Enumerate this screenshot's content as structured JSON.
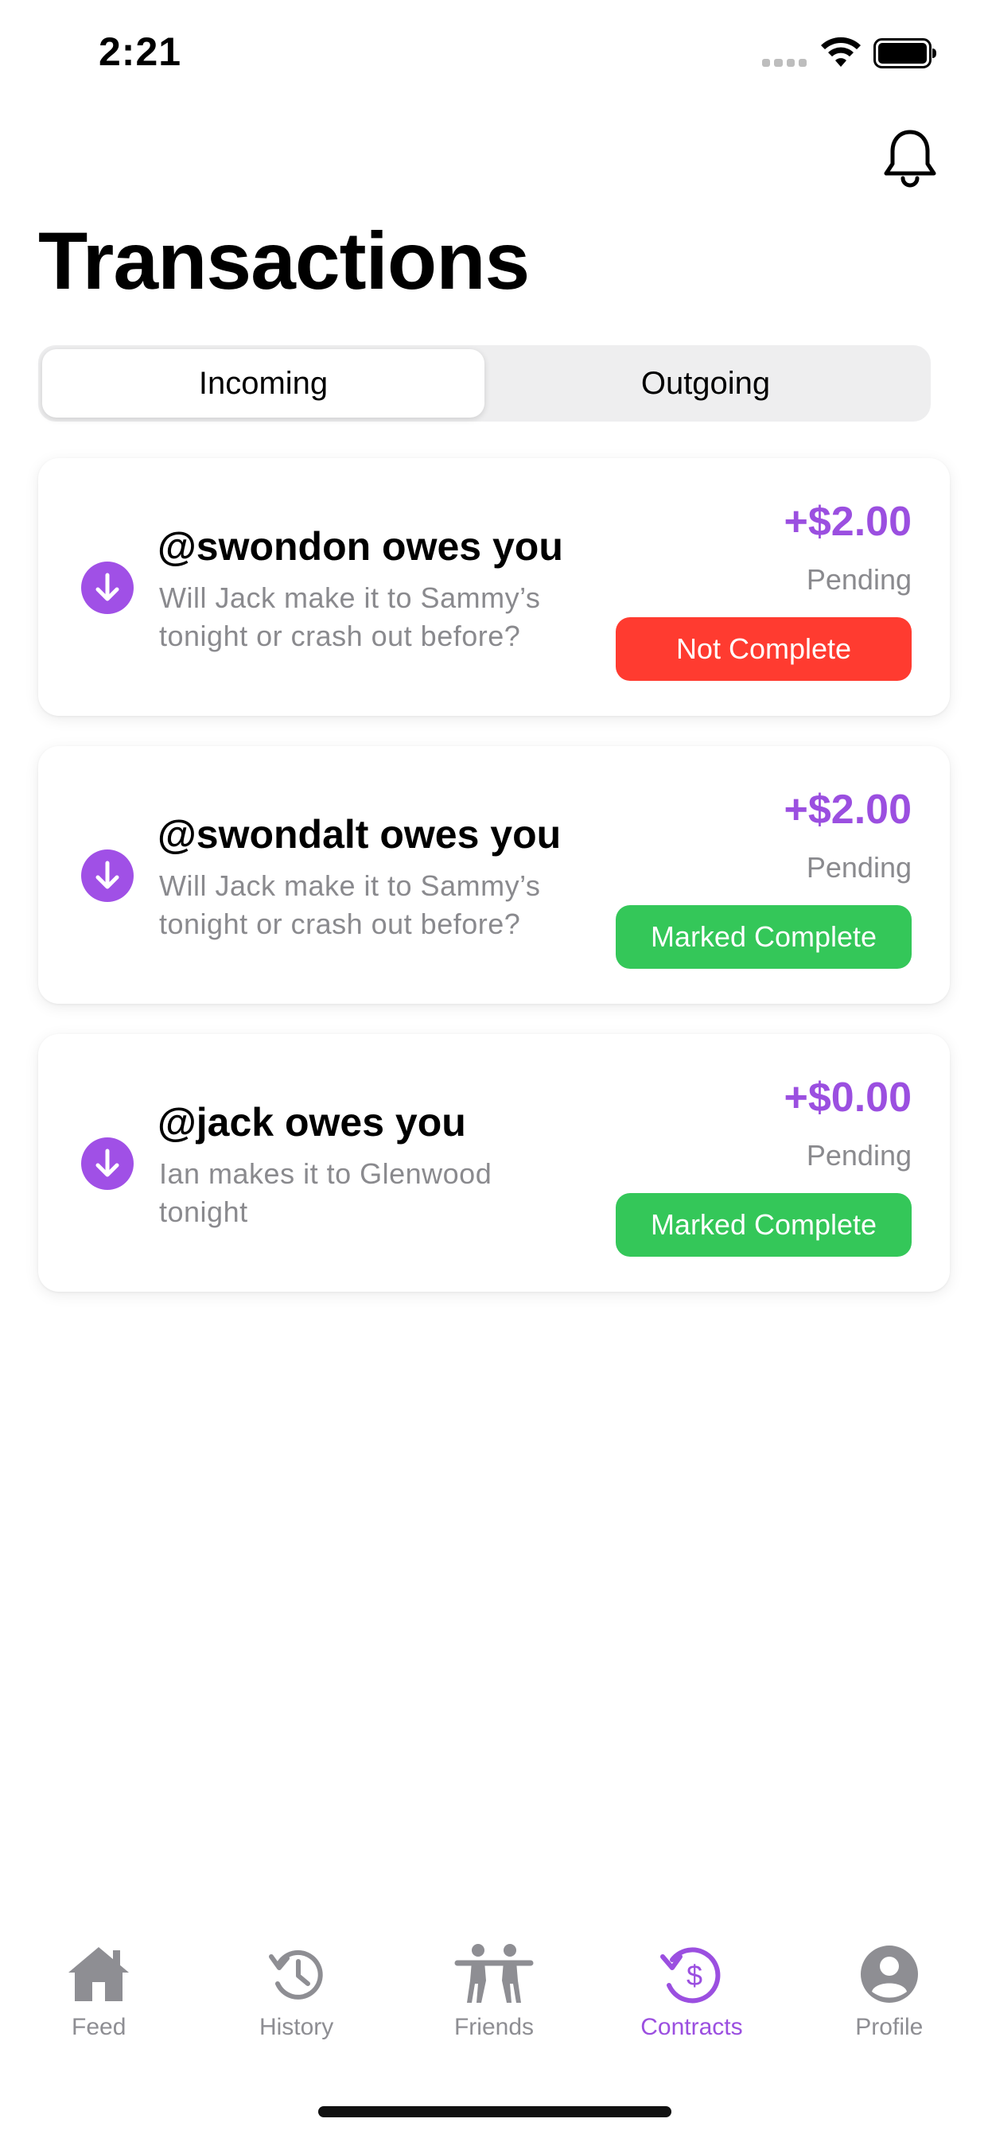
{
  "status_bar": {
    "time": "2:21"
  },
  "header": {
    "title": "Transactions",
    "bell_icon": "bell-icon"
  },
  "segmented_control": {
    "tabs": [
      {
        "label": "Incoming",
        "active": true
      },
      {
        "label": "Outgoing",
        "active": false
      }
    ]
  },
  "transactions": [
    {
      "title": "@swondon owes you",
      "description": "Will Jack make it to Sammy’s tonight or crash out before?",
      "amount": "+$2.00",
      "status": "Pending",
      "action_label": "Not Complete",
      "action_color": "#ff3b30"
    },
    {
      "title": "@swondalt owes you",
      "description": "Will Jack make it to Sammy’s tonight or crash out before?",
      "amount": "+$2.00",
      "status": "Pending",
      "action_label": "Marked Complete",
      "action_color": "#34c759"
    },
    {
      "title": "@jack owes you",
      "description": "Ian makes it to Glenwood tonight",
      "amount": "+$0.00",
      "status": "Pending",
      "action_label": "Marked Complete",
      "action_color": "#34c759"
    }
  ],
  "tab_bar": {
    "items": [
      {
        "label": "Feed",
        "icon": "home-icon",
        "active": false
      },
      {
        "label": "History",
        "icon": "history-icon",
        "active": false
      },
      {
        "label": "Friends",
        "icon": "friends-icon",
        "active": false
      },
      {
        "label": "Contracts",
        "icon": "contracts-dollar-icon",
        "active": true
      },
      {
        "label": "Profile",
        "icon": "profile-icon",
        "active": false
      }
    ]
  },
  "colors": {
    "accent": "#9b4fe0",
    "inactive": "#8e8e93",
    "danger": "#ff3b30",
    "success": "#34c759"
  }
}
